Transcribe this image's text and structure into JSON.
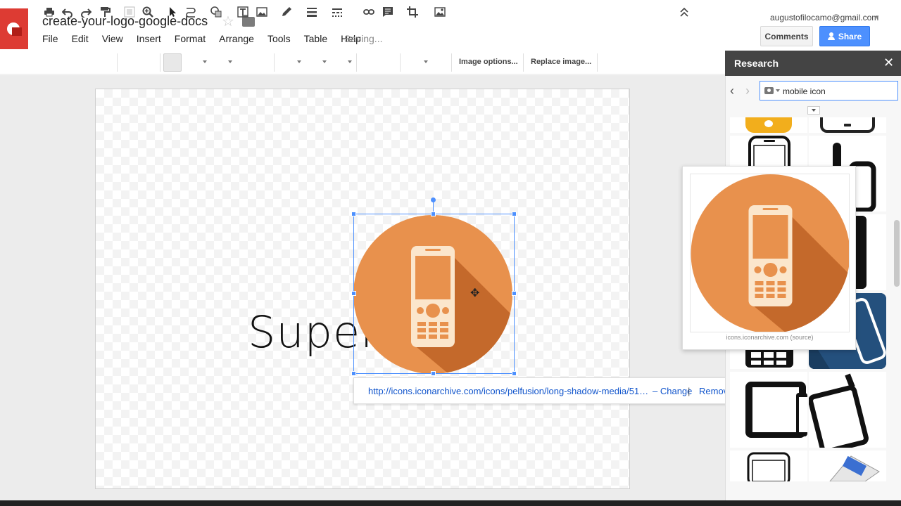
{
  "document": {
    "title": "create-your-logo-google-docs",
    "status": "Saving..."
  },
  "menu": [
    "File",
    "Edit",
    "View",
    "Insert",
    "Format",
    "Arrange",
    "Tools",
    "Table",
    "Help"
  ],
  "account": {
    "email": "augustofilocamo@gmail.com",
    "comments_label": "Comments",
    "share_label": "Share"
  },
  "toolbar": {
    "image_options_label": "Image options...",
    "replace_image_label": "Replace image..."
  },
  "canvas": {
    "text": "Super",
    "link_url": "http://icons.iconarchive.com/icons/pelfusion/long-shadow-media/51…",
    "link_change": "– Change",
    "link_separator": "|",
    "link_remove": "Remove"
  },
  "research": {
    "title": "Research",
    "search_value": "mobile icon",
    "preview_source": "icons.iconarchive.com (source)"
  },
  "colors": {
    "accent": "#4d90fe",
    "logo_red": "#dd3b33",
    "icon_orange": "#e8914d",
    "icon_shadow": "#c4692b",
    "phone_cream": "#fbe6cc"
  }
}
